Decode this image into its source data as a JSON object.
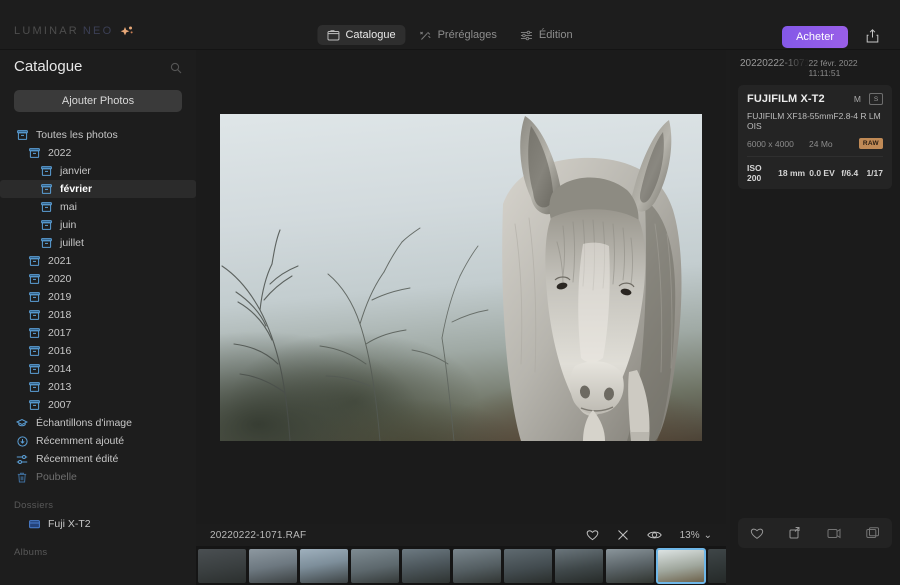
{
  "app": {
    "brand_primary": "LUMINAR",
    "brand_secondary": "NEO",
    "accent_color": "#8f5ee8"
  },
  "topbar": {
    "nav": [
      {
        "label": "Catalogue",
        "icon": "catalogue-icon",
        "active": true
      },
      {
        "label": "Préréglages",
        "icon": "presets-icon",
        "active": false
      },
      {
        "label": "Édition",
        "icon": "edit-sliders-icon",
        "active": false
      }
    ],
    "buy_label": "Acheter",
    "share_icon": "share-icon"
  },
  "sidebar": {
    "title": "Catalogue",
    "search_icon": "search-icon",
    "add_photos_label": "Ajouter Photos",
    "tree": [
      {
        "label": "Toutes les photos",
        "level": 0,
        "icon": "archive-icon",
        "selected": false,
        "dim": false
      },
      {
        "label": "2022",
        "level": 1,
        "icon": "archive-icon",
        "selected": false,
        "dim": false
      },
      {
        "label": "janvier",
        "level": 2,
        "icon": "archive-icon",
        "selected": false,
        "dim": false
      },
      {
        "label": "février",
        "level": 2,
        "icon": "archive-icon",
        "selected": true,
        "dim": false
      },
      {
        "label": "mai",
        "level": 2,
        "icon": "archive-icon",
        "selected": false,
        "dim": false
      },
      {
        "label": "juin",
        "level": 2,
        "icon": "archive-icon",
        "selected": false,
        "dim": false
      },
      {
        "label": "juillet",
        "level": 2,
        "icon": "archive-icon",
        "selected": false,
        "dim": false
      },
      {
        "label": "2021",
        "level": 1,
        "icon": "archive-icon",
        "selected": false,
        "dim": false
      },
      {
        "label": "2020",
        "level": 1,
        "icon": "archive-icon",
        "selected": false,
        "dim": false
      },
      {
        "label": "2019",
        "level": 1,
        "icon": "archive-icon",
        "selected": false,
        "dim": false
      },
      {
        "label": "2018",
        "level": 1,
        "icon": "archive-icon",
        "selected": false,
        "dim": false
      },
      {
        "label": "2017",
        "level": 1,
        "icon": "archive-icon",
        "selected": false,
        "dim": false
      },
      {
        "label": "2016",
        "level": 1,
        "icon": "archive-icon",
        "selected": false,
        "dim": false
      },
      {
        "label": "2014",
        "level": 1,
        "icon": "archive-icon",
        "selected": false,
        "dim": false
      },
      {
        "label": "2013",
        "level": 1,
        "icon": "archive-icon",
        "selected": false,
        "dim": false
      },
      {
        "label": "2007",
        "level": 1,
        "icon": "archive-icon",
        "selected": false,
        "dim": false
      },
      {
        "label": "Échantillons d'image",
        "level": 0,
        "icon": "samples-icon",
        "selected": false,
        "dim": false
      },
      {
        "label": "Récemment ajouté",
        "level": 0,
        "icon": "recently-added-icon",
        "selected": false,
        "dim": false
      },
      {
        "label": "Récemment édité",
        "level": 0,
        "icon": "recently-edited-icon",
        "selected": false,
        "dim": false
      },
      {
        "label": "Poubelle",
        "level": 0,
        "icon": "trash-icon",
        "selected": false,
        "dim": true
      }
    ],
    "folders_label": "Dossiers",
    "folders": [
      {
        "label": "Fuji X-T2",
        "icon": "folder-icon"
      }
    ],
    "albums_label": "Albums"
  },
  "canvas": {
    "filename": "20220222-1071.RAF",
    "tool_icons": [
      {
        "name": "favorite-heart-icon"
      },
      {
        "name": "reject-cross-icon"
      },
      {
        "name": "preview-eye-icon"
      }
    ],
    "zoom_level": "13%",
    "zoom_caret": "⌄",
    "photo_alt": "Close-up of a grey donkey on a foggy hillside with bare branches"
  },
  "filmstrip": {
    "thumbnails": [
      {
        "index": 1,
        "selected": false
      },
      {
        "index": 2,
        "selected": false
      },
      {
        "index": 3,
        "selected": false
      },
      {
        "index": 4,
        "selected": false
      },
      {
        "index": 5,
        "selected": false
      },
      {
        "index": 6,
        "selected": false
      },
      {
        "index": 7,
        "selected": false
      },
      {
        "index": 8,
        "selected": false
      },
      {
        "index": 9,
        "selected": false
      },
      {
        "index": 10,
        "selected": true
      },
      {
        "index": 11,
        "selected": false
      },
      {
        "index": 12,
        "selected": false
      },
      {
        "index": 13,
        "selected": false
      },
      {
        "index": 14,
        "selected": false
      }
    ]
  },
  "rightpanel": {
    "filename": "20220222-1071",
    "date": "22 févr. 2022 11:11:51",
    "camera": "FUJIFILM X-T2",
    "exposure_mode": "M",
    "metering_badge": "S",
    "lens": "FUJIFILM XF18-55mmF2.8-4 R LM OIS",
    "dimensions": "6000 x 4000",
    "filesize": "24 Mo",
    "format_badge": "RAW",
    "exif": {
      "iso": "ISO 200",
      "focal_length": "18 mm",
      "exposure_comp": "0.0 EV",
      "aperture": "f/6.4",
      "shutter": "1/17"
    },
    "bottom_icons": [
      {
        "name": "favorite-heart-icon"
      },
      {
        "name": "export-icon"
      },
      {
        "name": "copy-icon"
      },
      {
        "name": "duplicate-icon"
      }
    ]
  }
}
